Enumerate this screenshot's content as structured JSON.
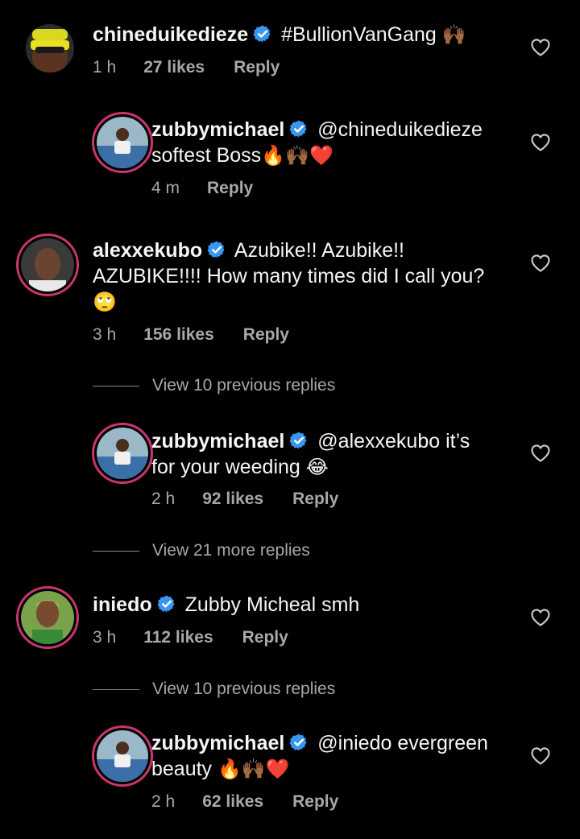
{
  "comments": [
    {
      "username": "chineduikedieze",
      "text": "#BullionVanGang",
      "emoji": "🙌🏾",
      "time": "1 h",
      "likes": "27 likes",
      "reply": "Reply"
    },
    {
      "username": "zubbymichael",
      "mention": "@chineduikedieze",
      "text": "softest Boss",
      "emoji": "🔥🙌🏾❤️",
      "time": "4 m",
      "reply": "Reply"
    },
    {
      "username": "alexxekubo",
      "text_line1": "Azubike!! Azubike!!",
      "text_line2": "AZUBIKE!!!! How many times did I call you?",
      "emoji": "🙄",
      "time": "3 h",
      "likes": "156 likes",
      "reply": "Reply"
    },
    {
      "username": "zubbymichael",
      "mention": "@alexxekubo",
      "text_line1": "it’s",
      "text_line2": "for your weeding",
      "emoji": "😂",
      "time": "2 h",
      "likes": "92 likes",
      "reply": "Reply"
    },
    {
      "username": "iniedo",
      "text": "Zubby Micheal smh",
      "time": "3 h",
      "likes": "112 likes",
      "reply": "Reply"
    },
    {
      "username": "zubbymichael",
      "mention": "@iniedo",
      "text_line1": "evergreen",
      "text_line2": "beauty",
      "emoji": "🔥🙌🏾❤️",
      "time": "2 h",
      "likes": "62 likes",
      "reply": "Reply"
    }
  ],
  "view_replies": [
    "View 10 previous replies",
    "View 21 more replies",
    "View 10 previous replies"
  ],
  "colors": {
    "background": "#000000",
    "text": "#f5f5f5",
    "secondary": "#a8a8a8",
    "verified": "#3897f0",
    "story_ring": "#c9356e"
  },
  "icons": [
    "verified-badge-icon",
    "heart-outline-icon"
  ]
}
